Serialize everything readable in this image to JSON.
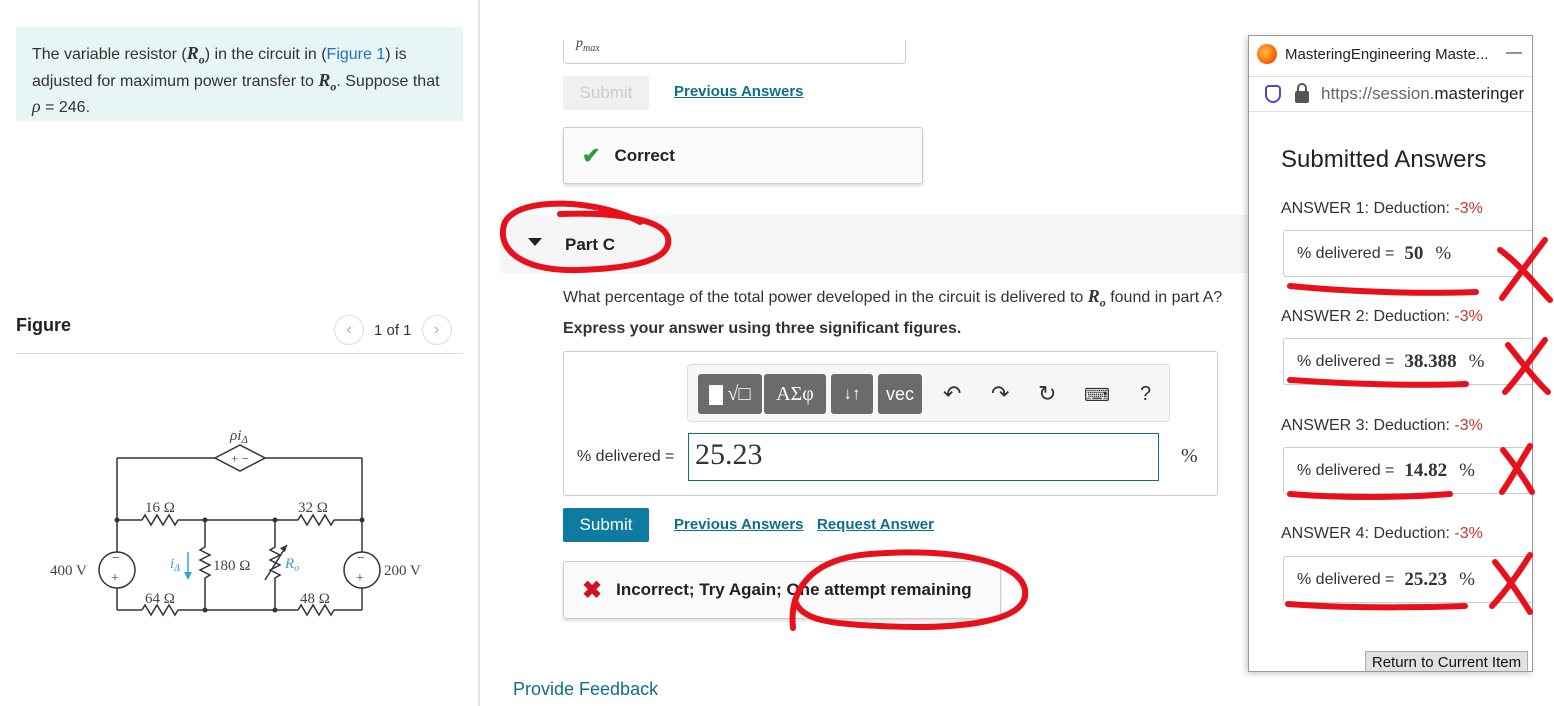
{
  "problem": {
    "text_a": "The variable resistor (",
    "var_R": "R",
    "var_sub": "o",
    "text_b": ") in the circuit in (",
    "figure_link": "Figure 1",
    "text_c": ") is adjusted for maximum power transfer to ",
    "text_d": ". Suppose that ",
    "rho": "ρ",
    "text_e": " = 246."
  },
  "figure": {
    "title": "Figure",
    "pager": "1 of 1",
    "labels": {
      "dep_source": "ρi",
      "dep_sub": "Δ",
      "v400": "400 V",
      "v200": "200 V",
      "r16": "16 Ω",
      "r32": "32 Ω",
      "r64": "64 Ω",
      "r48": "48 Ω",
      "r180": "180 Ω",
      "i_delta": "i",
      "i_sub": "Δ",
      "ro": "R",
      "ro_sub": "o"
    }
  },
  "part_b": {
    "clipped_label": "p",
    "clipped_sub": "max",
    "submit": "Submit",
    "previous_answers": "Previous Answers",
    "correct": "Correct"
  },
  "part_c": {
    "label": "Part C",
    "question_a": "What percentage of the total power developed in the circuit is delivered to ",
    "question_b": " found in part A?",
    "instruction": "Express your answer using three significant figures.",
    "toolbar": {
      "templates": "√□",
      "greek": "ΑΣφ",
      "updown": "↓↑",
      "vec": "vec",
      "help": "?"
    },
    "field_label": "% delivered =",
    "field_value": "25.23",
    "unit": "%",
    "submit": "Submit",
    "previous_answers": "Previous Answers",
    "request_answer": "Request Answer",
    "incorrect": "Incorrect; Try Again; One attempt remaining"
  },
  "feedback": "Provide Feedback",
  "popup": {
    "window_title": "MasteringEngineering Maste...",
    "minimize": "—",
    "url_prefix": "https://session.",
    "url_host": "masteringer",
    "heading": "Submitted Answers",
    "answers": [
      {
        "label": "ANSWER 1: Deduction: ",
        "deduction": "-3%",
        "field": "% delivered =",
        "value": "50",
        "unit": "%"
      },
      {
        "label": "ANSWER 2: Deduction: ",
        "deduction": "-3%",
        "field": "% delivered =",
        "value": "38.388",
        "unit": "%"
      },
      {
        "label": "ANSWER 3: Deduction: ",
        "deduction": "-3%",
        "field": "% delivered =",
        "value": "14.82",
        "unit": "%"
      },
      {
        "label": "ANSWER 4: Deduction: ",
        "deduction": "-3%",
        "field": "% delivered =",
        "value": "25.23",
        "unit": "%"
      }
    ],
    "return_button": "Return to Current Item"
  },
  "colors": {
    "accent": "#0e7ca0",
    "correct": "#2c9c3a",
    "incorrect": "#d1121e",
    "annotation": "#e8101a"
  }
}
